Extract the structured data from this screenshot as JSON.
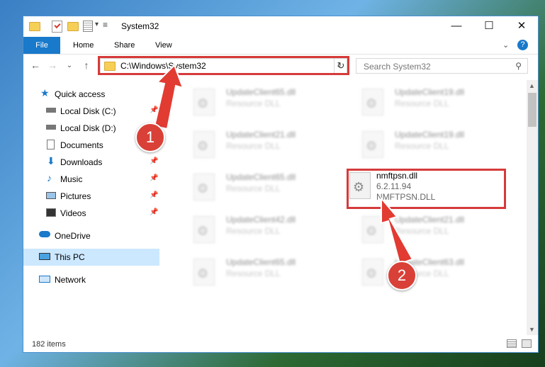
{
  "window": {
    "title": "System32"
  },
  "ribbon": {
    "file": "File",
    "home": "Home",
    "share": "Share",
    "view": "View"
  },
  "window_controls": {
    "minimize": "—",
    "maximize": "☐",
    "close": "✕"
  },
  "address": {
    "path": "C:\\Windows\\System32"
  },
  "search": {
    "placeholder": "Search System32"
  },
  "sidebar": {
    "quick_access": "Quick access",
    "items": [
      "Local Disk (C:)",
      "Local Disk (D:)",
      "Documents",
      "Downloads",
      "Music",
      "Pictures",
      "Videos"
    ],
    "onedrive": "OneDrive",
    "this_pc": "This PC",
    "network": "Network"
  },
  "files": [
    {
      "name": "UpdateClient65.dll",
      "desc": "Resource DLL"
    },
    {
      "name": "UpdateClient19.dll",
      "desc": "Resource DLL"
    },
    {
      "name": "UpdateClient21.dll",
      "desc": "Resource DLL"
    },
    {
      "name": "UpdateClient19.dll",
      "desc": "Resource DLL"
    },
    {
      "name": "UpdateClient65.dll",
      "desc": "Resource DLL"
    },
    {
      "name": "nmftpsn.dll",
      "desc": "6.2.11.94",
      "desc2": "NMFTPSN.DLL"
    },
    {
      "name": "UpdateClient42.dll",
      "desc": "Resource DLL"
    },
    {
      "name": "UpdateClient21.dll",
      "desc": "Resource DLL"
    },
    {
      "name": "UpdateClient65.dll",
      "desc": "Resource DLL"
    },
    {
      "name": "UpdateClient63.dll",
      "desc": "Resource DLL"
    }
  ],
  "status": {
    "count": "182 items"
  },
  "annotations": {
    "badge1": "1",
    "badge2": "2"
  }
}
